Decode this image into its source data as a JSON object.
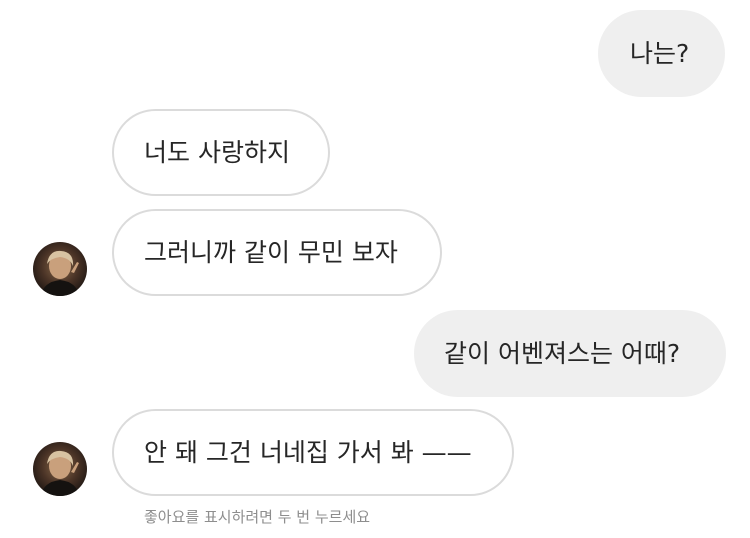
{
  "messages": [
    {
      "direction": "outgoing",
      "text": "나는?"
    },
    {
      "direction": "incoming",
      "text": "너도 사랑하지"
    },
    {
      "direction": "incoming",
      "text": "그러니까 같이 무민 보자"
    },
    {
      "direction": "outgoing",
      "text": "같이 어벤져스는 어때?"
    },
    {
      "direction": "incoming",
      "text": "안 돼 그건 너네집 가서 봐 ——"
    }
  ],
  "like_hint": "좋아요를 표시하려면 두 번 누르세요",
  "colors": {
    "outgoing_bubble": "#efefef",
    "incoming_border": "#dbdbdb",
    "text": "#262626",
    "hint": "#8e8e8e"
  }
}
